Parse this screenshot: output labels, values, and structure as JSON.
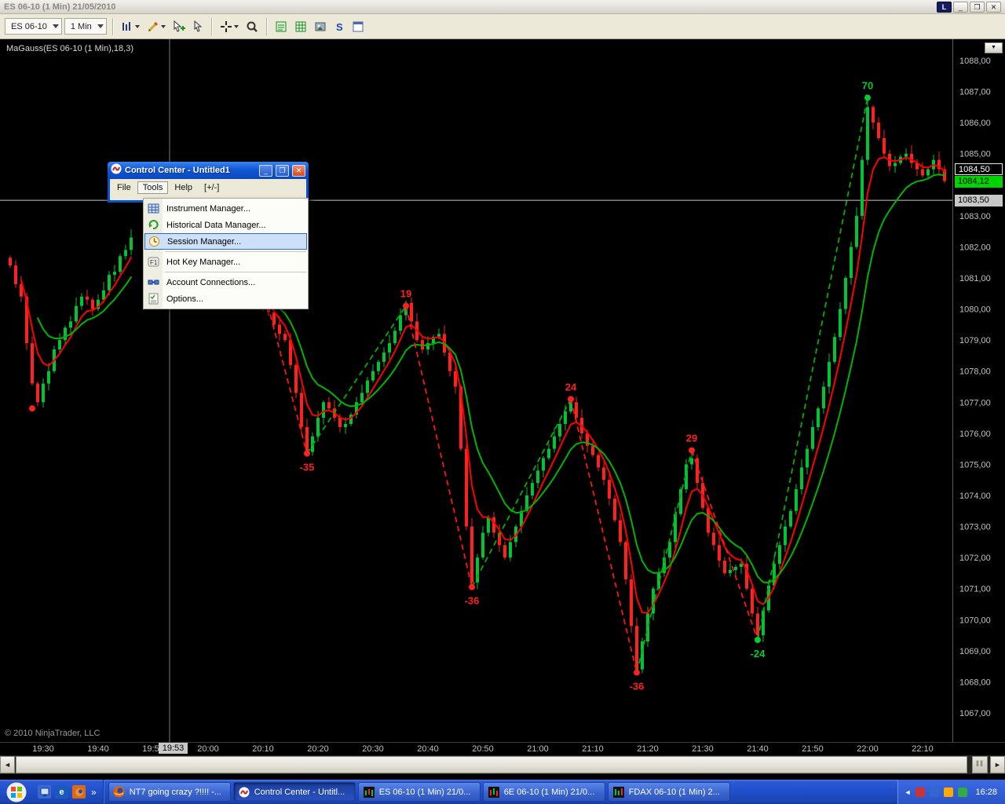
{
  "window": {
    "title": "ES 06-10 (1 Min)  21/05/2010",
    "log_button_label": "L"
  },
  "toolbar": {
    "instrument": "ES 06-10",
    "interval": "1 Min",
    "icons": [
      "chart-style",
      "drawing-tools",
      "add-object",
      "cursor",
      "crosshair",
      "zoom",
      "data-box",
      "chart-grid",
      "save-image",
      "snapshot",
      "chart-panel"
    ]
  },
  "chart": {
    "indicator_label": "MaGauss(ES 06-10 (1 Min),18,3)",
    "copyright": "© 2010 NinjaTrader, LLC",
    "indicator_value": "1084,50",
    "last_price": "1084,12",
    "crosshair_price": "1083,50",
    "crosshair_time": "19:53",
    "axis_menu_glyph": "▼",
    "price_axis_labels": [
      "1088,00",
      "1087,00",
      "1086,00",
      "1085,00",
      "1083,00",
      "1082,00",
      "1081,00",
      "1080,00",
      "1079,00",
      "1078,00",
      "1077,00",
      "1076,00",
      "1075,00",
      "1074,00",
      "1073,00",
      "1072,00",
      "1071,00",
      "1070,00",
      "1069,00",
      "1068,00",
      "1067,00"
    ],
    "time_axis_labels": [
      "19:30",
      "19:40",
      "19:50",
      "20:00",
      "20:10",
      "20:20",
      "20:30",
      "20:40",
      "20:50",
      "21:00",
      "21:10",
      "21:20",
      "21:30",
      "21:40",
      "21:50",
      "22:00",
      "22:10"
    ],
    "colors": {
      "up": "#00c435",
      "down": "#ff2020",
      "ma_fast": "#ff0000",
      "ma_slow": "#00b400",
      "zig_up": "#00b000",
      "zig_down": "#ff1414",
      "axis_text": "#c0c0c0",
      "crosshair_v": "#7d7d7d",
      "crosshair_h": "#c8c8c8",
      "last_price_bg": "#00d400"
    }
  },
  "chart_data": {
    "type": "candlestick",
    "symbol": "ES 06-10",
    "interval": "1 Min",
    "y_axis": {
      "min": 1067,
      "max": 1088
    },
    "x_axis": {
      "start": "19:23",
      "end": "22:15"
    },
    "clusters": [
      {
        "start_time": "19:24",
        "closes": [
          1081.4,
          1080.8,
          1080.4,
          1078.9,
          1077.6,
          1077.0,
          1077.6,
          1078.0,
          1078.7,
          1079.0,
          1079.4,
          1079.6,
          1080.1,
          1080.4,
          1080.3,
          1080.0,
          1080.3,
          1080.6,
          1081.1,
          1081.2,
          1081.7,
          1081.9,
          1082.3
        ]
      },
      {
        "start_time": "20:06",
        "closes": [
          1080.6,
          1080.4,
          1080.5,
          1080.2,
          1080.0,
          1079.9,
          1079.5,
          1079.2,
          1079.0,
          1078.2,
          1077.3,
          1076.2,
          1075.4,
          1075.9,
          1076.5,
          1077.0,
          1076.8,
          1076.5,
          1076.2,
          1076.3,
          1076.6,
          1077.0,
          1077.3,
          1077.7,
          1078.0,
          1078.3,
          1078.6,
          1078.9,
          1079.3,
          1079.8,
          1080.2,
          1079.6,
          1079.0,
          1078.7,
          1078.9,
          1079.1,
          1079.2,
          1078.6,
          1078.0,
          1077.5,
          1075.5,
          1073.0,
          1071.2,
          1072.0,
          1072.8,
          1073.3,
          1072.8,
          1072.4,
          1072.0,
          1072.5,
          1073.0,
          1073.5,
          1074.0,
          1074.4,
          1074.8,
          1075.2,
          1075.5,
          1075.9,
          1076.3,
          1076.7,
          1077.0,
          1076.5,
          1076.0,
          1075.6,
          1075.3,
          1074.9,
          1074.5,
          1073.9,
          1073.2,
          1072.5,
          1071.3,
          1069.8,
          1068.4,
          1069.3,
          1070.2,
          1071.0,
          1071.5,
          1072.0,
          1072.5,
          1073.4,
          1074.2,
          1075.0,
          1075.2,
          1074.4,
          1073.6,
          1072.8,
          1072.4,
          1071.9,
          1071.5,
          1071.6,
          1071.7,
          1071.8,
          1071.0,
          1070.2,
          1069.5,
          1070.3,
          1071.1,
          1071.8,
          1072.4,
          1073.0,
          1073.5,
          1074.2,
          1074.9,
          1075.5,
          1076.2,
          1076.8,
          1077.5,
          1078.3,
          1079.1,
          1080.0,
          1081.0,
          1082.0,
          1083.0,
          1084.8,
          1086.5,
          1086.0,
          1085.5,
          1085.0,
          1084.6,
          1084.7,
          1084.9,
          1085.0,
          1084.7,
          1084.5,
          1084.3,
          1084.5,
          1084.8,
          1084.5,
          1084.12
        ]
      }
    ],
    "zigzag_points": [
      {
        "time": "20:10",
        "price": 1080.7,
        "label": "",
        "color": ""
      },
      {
        "time": "20:18",
        "price": 1075.35,
        "label": "-35",
        "color": "#ff2020"
      },
      {
        "time": "20:36",
        "price": 1080.1,
        "label": "19",
        "color": "#ff2020"
      },
      {
        "time": "20:48",
        "price": 1071.05,
        "label": "-36",
        "color": "#ff2020"
      },
      {
        "time": "21:06",
        "price": 1077.1,
        "label": "24",
        "color": "#ff2020"
      },
      {
        "time": "21:18",
        "price": 1068.3,
        "label": "-36",
        "color": "#ff2020"
      },
      {
        "time": "21:28",
        "price": 1075.45,
        "label": "29",
        "color": "#ff2020"
      },
      {
        "time": "21:40",
        "price": 1069.35,
        "label": "-24",
        "color": "#00cc33"
      },
      {
        "time": "22:00",
        "price": 1086.8,
        "label": "70",
        "color": "#00cc33"
      }
    ],
    "isolated_dots": [
      {
        "time": "19:28",
        "price": 1076.8,
        "color": "#ff2020"
      }
    ]
  },
  "control_center": {
    "title": "Control Center - Untitled1",
    "menus": [
      "File",
      "Tools",
      "Help",
      "[+/-]"
    ],
    "tools_menu": [
      "Instrument Manager...",
      "Historical Data Manager...",
      "Session Manager...",
      "Hot Key Manager...",
      "Account Connections...",
      "Options..."
    ],
    "selected_item": "Session Manager..."
  },
  "taskbar": {
    "overflow_chevron": "»",
    "tasks": [
      {
        "label": "NT7 going crazy ?!!!! -...",
        "icon": "firefox"
      },
      {
        "label": "Control Center - Untitl...",
        "icon": "ninjatrader",
        "active": true
      },
      {
        "label": "ES 06-10 (1 Min)  21/0...",
        "icon": "chart"
      },
      {
        "label": "6E 06-10 (1 Min)  21/0...",
        "icon": "chart"
      },
      {
        "label": "FDAX 06-10 (1 Min)  2...",
        "icon": "chart"
      }
    ],
    "clock": "16:28"
  }
}
